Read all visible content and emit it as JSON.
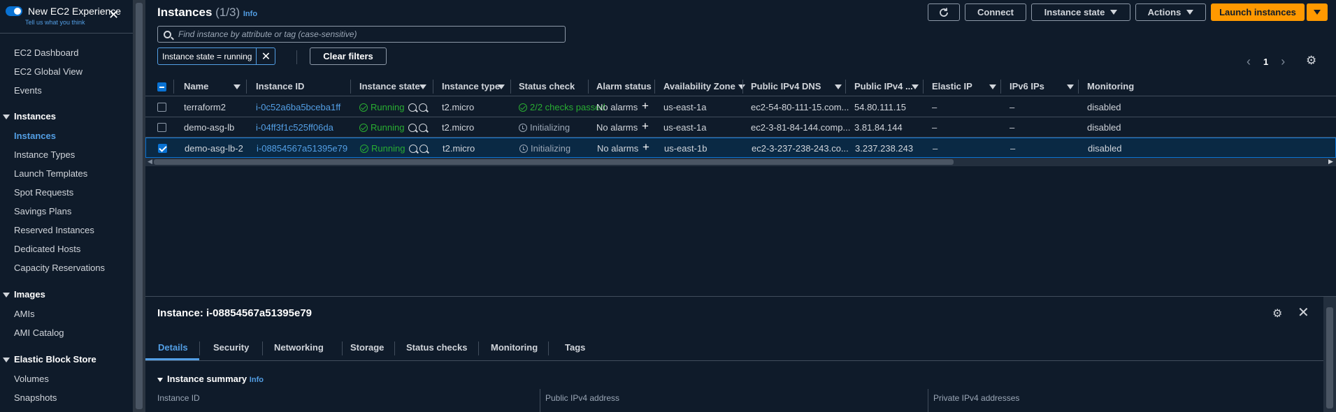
{
  "sidebar": {
    "experience_title": "New EC2 Experience",
    "experience_sub": "Tell us what you think",
    "items": [
      {
        "label": "EC2 Dashboard"
      },
      {
        "label": "EC2 Global View"
      },
      {
        "label": "Events"
      }
    ],
    "sections": [
      {
        "title": "Instances",
        "items": [
          "Instances",
          "Instance Types",
          "Launch Templates",
          "Spot Requests",
          "Savings Plans",
          "Reserved Instances",
          "Dedicated Hosts",
          "Capacity Reservations"
        ]
      },
      {
        "title": "Images",
        "items": [
          "AMIs",
          "AMI Catalog"
        ]
      },
      {
        "title": "Elastic Block Store",
        "items": [
          "Volumes",
          "Snapshots"
        ]
      }
    ]
  },
  "header": {
    "title": "Instances",
    "count": "(1/3)",
    "info": "Info",
    "connect": "Connect",
    "instance_state": "Instance state",
    "actions": "Actions",
    "launch": "Launch instances"
  },
  "search": {
    "placeholder": "Find instance by attribute or tag (case-sensitive)"
  },
  "filter": {
    "token": "Instance state = running",
    "clear": "Clear filters"
  },
  "pager": {
    "page": "1"
  },
  "table": {
    "columns": [
      "Name",
      "Instance ID",
      "Instance state",
      "Instance type",
      "Status check",
      "Alarm status",
      "Availability Zone",
      "Public IPv4 DNS",
      "Public IPv4 ...",
      "Elastic IP",
      "IPv6 IPs",
      "Monitoring"
    ],
    "rows": [
      {
        "name": "terraform2",
        "id": "i-0c52a6ba5bceba1ff",
        "state": "Running",
        "type": "t2.micro",
        "status": "2/2 checks passed",
        "alarm": "No alarms",
        "az": "us-east-1a",
        "dns": "ec2-54-80-111-15.com...",
        "ip": "54.80.111.15",
        "eip": "–",
        "ipv6": "–",
        "monitoring": "disabled",
        "selected": false
      },
      {
        "name": "demo-asg-lb",
        "id": "i-04ff3f1c525ff06da",
        "state": "Running",
        "type": "t2.micro",
        "status": "Initializing",
        "alarm": "No alarms",
        "az": "us-east-1a",
        "dns": "ec2-3-81-84-144.comp...",
        "ip": "3.81.84.144",
        "eip": "–",
        "ipv6": "–",
        "monitoring": "disabled",
        "selected": false
      },
      {
        "name": "demo-asg-lb-2",
        "id": "i-08854567a51395e79",
        "state": "Running",
        "type": "t2.micro",
        "status": "Initializing",
        "alarm": "No alarms",
        "az": "us-east-1b",
        "dns": "ec2-3-237-238-243.co...",
        "ip": "3.237.238.243",
        "eip": "–",
        "ipv6": "–",
        "monitoring": "disabled",
        "selected": true
      }
    ]
  },
  "details": {
    "title": "Instance: i-08854567a51395e79",
    "tabs": [
      "Details",
      "Security",
      "Networking",
      "Storage",
      "Status checks",
      "Monitoring",
      "Tags"
    ],
    "summary": "Instance summary",
    "summary_info": "Info",
    "fields": [
      "Instance ID",
      "Public IPv4 address",
      "Private IPv4 addresses"
    ]
  },
  "colors": {
    "accent": "#539fe5",
    "launch": "#ff9900",
    "running": "#29ad32"
  }
}
